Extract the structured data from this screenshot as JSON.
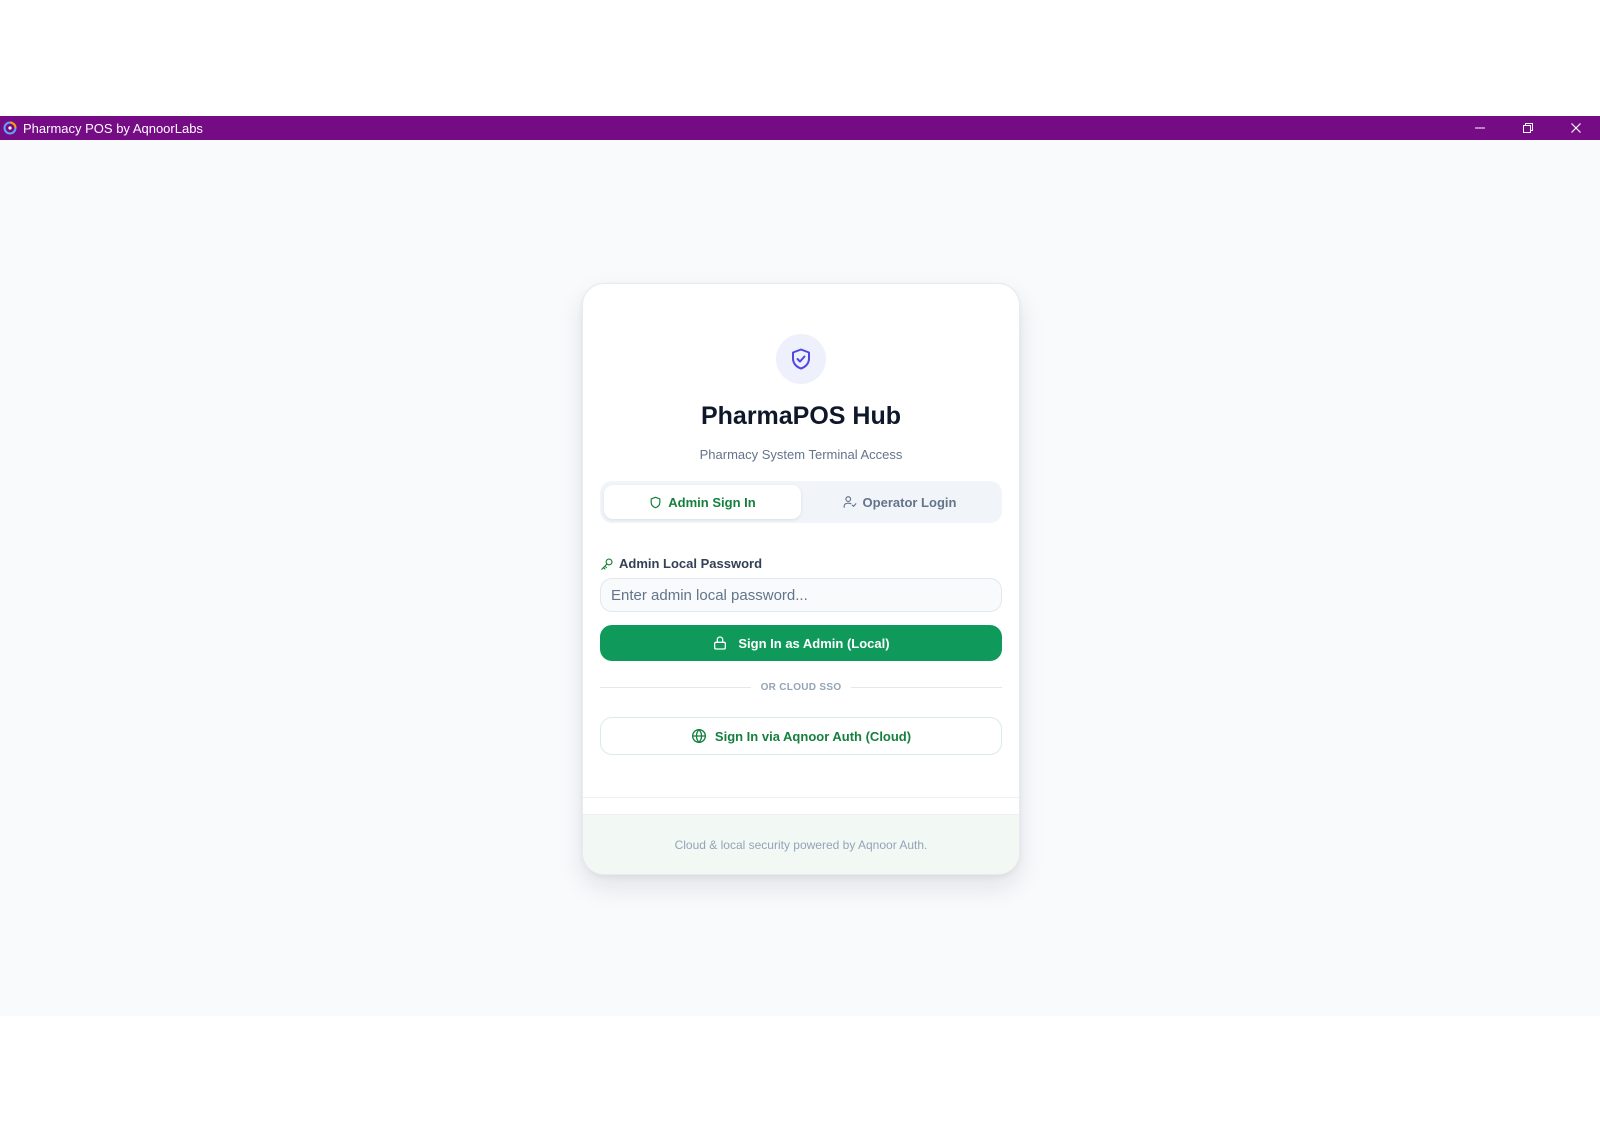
{
  "window": {
    "title": "Pharmacy POS by AqnoorLabs",
    "bar_color": "#760b86",
    "controls": [
      "minimize-icon",
      "restore-icon",
      "close-icon"
    ]
  },
  "card": {
    "logo_icon": "shield-check-icon",
    "title": "PharmaPOS Hub",
    "subtitle": "Pharmacy System Terminal Access",
    "tabs": [
      {
        "label": "Admin Sign In",
        "icon": "shield-icon",
        "active": true
      },
      {
        "label": "Operator Login",
        "icon": "user-check-icon",
        "active": false
      }
    ],
    "password_label": "Admin Local Password",
    "password_label_icon": "key-icon",
    "password_placeholder": "Enter admin local password...",
    "password_value": "",
    "primary_button": {
      "label": "Sign In as Admin (Local)",
      "icon": "lock-icon"
    },
    "divider_text": "OR CLOUD SSO",
    "cloud_button": {
      "label": "Sign In via Aqnoor Auth (Cloud)",
      "icon": "globe-icon"
    },
    "footer": "Cloud & local security powered by Aqnoor Auth."
  },
  "colors": {
    "accent_green": "#0f9a5c",
    "accent_text_green": "#15803d",
    "logo_indigo": "#4f46e5",
    "background": "#f8fafc"
  }
}
